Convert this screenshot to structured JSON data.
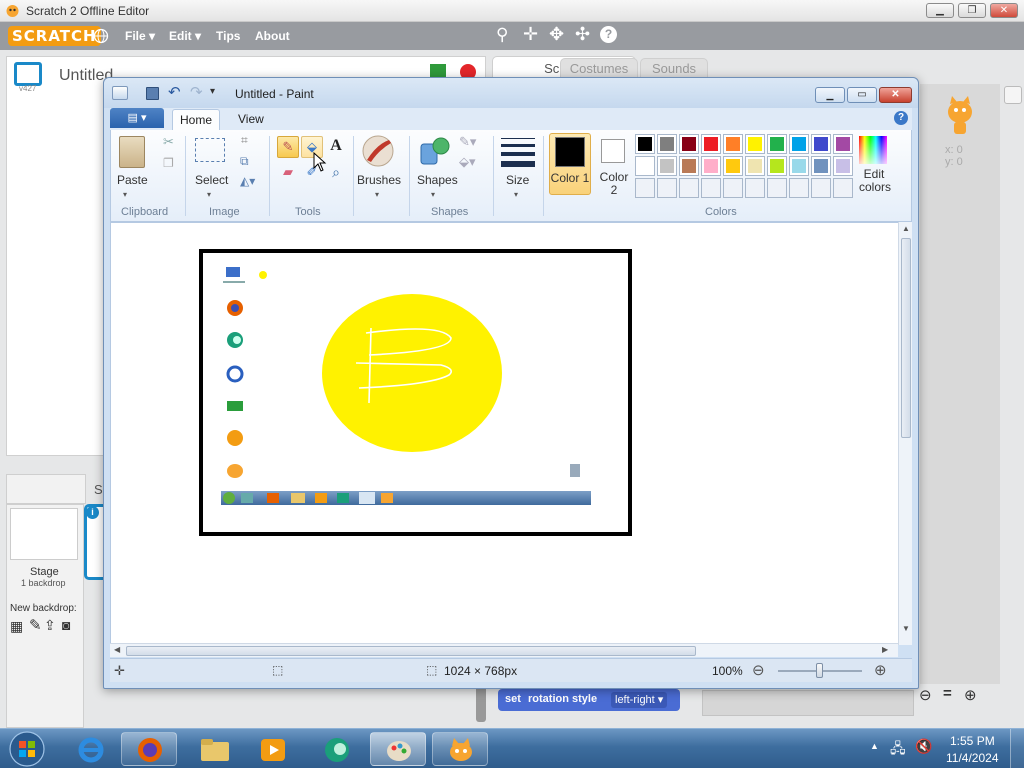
{
  "scratch": {
    "window_title": "Scratch 2 Offline Editor",
    "logo": "SCRATCH",
    "menu": [
      "File ▾",
      "Edit ▾",
      "Tips",
      "About"
    ],
    "project_title": "Untitled",
    "version": "v427",
    "tabs": [
      "Scripts",
      "Costumes",
      "Sounds"
    ],
    "sprite_xy": [
      "x: 0",
      "y: 0"
    ],
    "stage_label": "Stage",
    "stage_backdrops": "1 backdrop",
    "new_backdrop": "New backdrop:",
    "block": {
      "prefix": "set",
      "middle": "rotation style",
      "value": "left-right"
    },
    "sprite_tab_partial": "S"
  },
  "paint": {
    "window_title": "Untitled - Paint",
    "tabs": [
      "Home",
      "View"
    ],
    "groups": {
      "clipboard": "Clipboard",
      "image": "Image",
      "tools": "Tools",
      "shapes": "Shapes",
      "colors": "Colors"
    },
    "buttons": {
      "paste": "Paste",
      "select": "Select",
      "brushes": "Brushes",
      "shapes": "Shapes",
      "size": "Size",
      "color1": "Color 1",
      "color2": "Color 2",
      "edit_colors": "Edit colors"
    },
    "palette_row1": [
      "#000000",
      "#7f7f7f",
      "#880015",
      "#ed1c24",
      "#ff7f27",
      "#fff200",
      "#22b14c",
      "#00a2e8",
      "#3f48cc",
      "#a349a4"
    ],
    "palette_row2": [
      "#ffffff",
      "#c3c3c3",
      "#b97a57",
      "#ffaec9",
      "#ffc90e",
      "#efe4b0",
      "#b5e61d",
      "#99d9ea",
      "#7092be",
      "#c8bfe7"
    ],
    "status": {
      "dimensions": "1024 × 768px",
      "zoom": "100%"
    },
    "accent": "#fff200"
  },
  "taskbar": {
    "time": "1:55 PM",
    "date": "11/4/2024"
  }
}
